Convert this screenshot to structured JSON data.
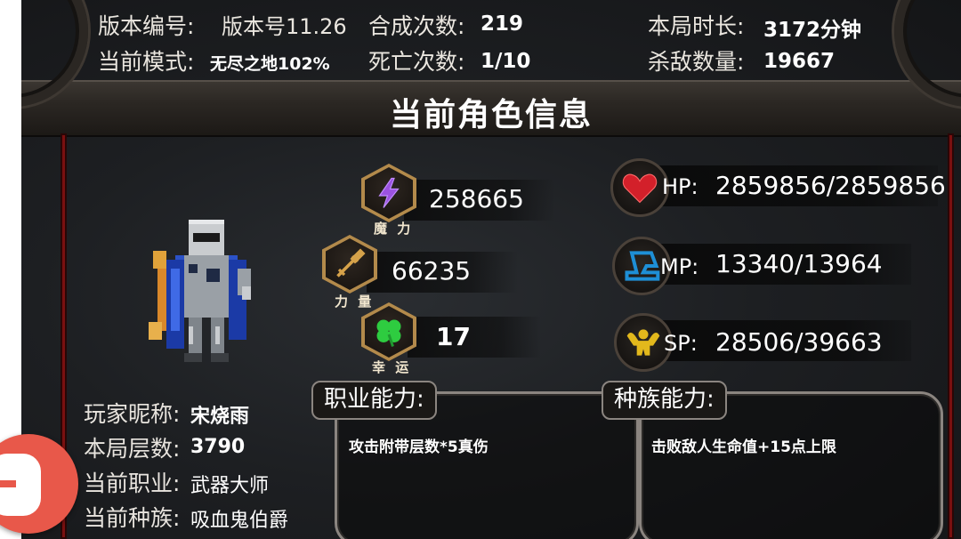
{
  "header": {
    "version": {
      "label": "版本编号:",
      "value": "版本号11.26"
    },
    "mode": {
      "label": "当前模式:",
      "value": "无尽之地102%"
    },
    "crafts": {
      "label": "合成次数:",
      "value": "219"
    },
    "deaths": {
      "label": "死亡次数:",
      "value": "1/10"
    },
    "duration": {
      "label": "本局时长:",
      "value": "3172分钟"
    },
    "kills": {
      "label": "杀敌数量:",
      "value": "19667"
    }
  },
  "section_title": "当前角色信息",
  "stats": [
    {
      "caption": "魔 力",
      "value": "258665",
      "icon": "lightning-icon",
      "color": "#9b52e0"
    },
    {
      "caption": "力 量",
      "value": "66235",
      "icon": "sword-icon",
      "color": "#d6a24a"
    },
    {
      "caption": "幸 运",
      "value": "17",
      "icon": "clover-icon",
      "color": "#2ecc40"
    }
  ],
  "attributes": [
    {
      "label": "HP:",
      "value": "2859856/2859856",
      "icon": "heart-icon",
      "color": "#d3202a"
    },
    {
      "label": "MP:",
      "value": "13340/13964",
      "icon": "boot-icon",
      "color": "#1e8fd6"
    },
    {
      "label": "SP:",
      "value": "28506/39663",
      "icon": "strongman-icon",
      "color": "#e2b81c"
    }
  ],
  "player": {
    "nickname": {
      "label": "玩家昵称:",
      "value": "宋烧雨"
    },
    "floor": {
      "label": "本局层数:",
      "value": "3790"
    },
    "job": {
      "label": "当前职业:",
      "value": "武器大师"
    },
    "race": {
      "label": "当前种族:",
      "value": "吸血鬼伯爵"
    }
  },
  "abilities": {
    "job": {
      "title": "职业能力:",
      "text": "攻击附带层数*5真伤"
    },
    "race": {
      "title": "种族能力:",
      "text": "击败敌人生命值+15点上限"
    }
  }
}
